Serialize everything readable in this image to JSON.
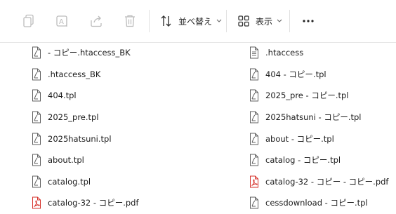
{
  "toolbar": {
    "sort_label": "並べ替え",
    "view_label": "表示",
    "buttons": [
      "copy-icon",
      "rename-icon",
      "share-icon",
      "delete-icon",
      "sort-icon",
      "view-icon",
      "more-icon"
    ]
  },
  "files": {
    "left": [
      {
        "name": " - コピー.htaccess_BK",
        "icon": "file-icon"
      },
      {
        "name": ".htaccess_BK",
        "icon": "file-icon"
      },
      {
        "name": "404.tpl",
        "icon": "file-icon"
      },
      {
        "name": "2025_pre.tpl",
        "icon": "file-icon"
      },
      {
        "name": "2025hatsuni.tpl",
        "icon": "file-icon"
      },
      {
        "name": "about.tpl",
        "icon": "file-icon"
      },
      {
        "name": "catalog.tpl",
        "icon": "file-icon"
      },
      {
        "name": "catalog-32 - コピー.pdf",
        "icon": "pdf-icon"
      }
    ],
    "right": [
      {
        "name": ".htaccess",
        "icon": "text-file-icon"
      },
      {
        "name": "404 - コピー.tpl",
        "icon": "file-icon"
      },
      {
        "name": "2025_pre - コピー.tpl",
        "icon": "file-icon"
      },
      {
        "name": "2025hatsuni - コピー.tpl",
        "icon": "file-icon"
      },
      {
        "name": "about - コピー.tpl",
        "icon": "file-icon"
      },
      {
        "name": "catalog - コピー.tpl",
        "icon": "file-icon"
      },
      {
        "name": "catalog-32 - コピー - コピー.pdf",
        "icon": "pdf-icon"
      },
      {
        "name": "cessdownload - コピー.tpl",
        "icon": "file-icon"
      }
    ]
  },
  "colors": {
    "pdf_red": "#d6312a",
    "icon_gray": "#5f5f5f",
    "disabled_gray": "#b8b8b8"
  }
}
